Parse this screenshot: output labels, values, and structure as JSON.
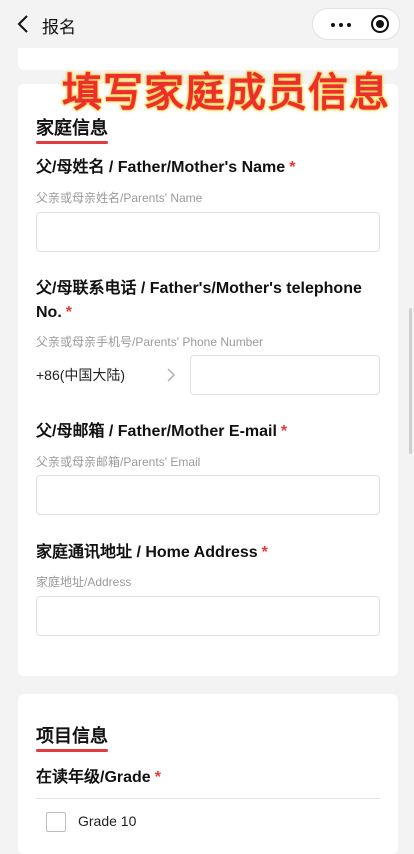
{
  "nav": {
    "title": "报名",
    "back_icon": "chevron-left-icon",
    "more_icon": "more-dots-icon",
    "close_icon": "target-circle-icon"
  },
  "banner": {
    "text": "填写家庭成员信息",
    "color": "#ec2e2c",
    "outline_color": "#fbe06b"
  },
  "family_section": {
    "heading": "家庭信息",
    "fields": [
      {
        "label": "父/母姓名 / Father/Mother's Name",
        "required_mark": "*",
        "hint": "父亲或母亲姓名/Parents' Name",
        "value": ""
      },
      {
        "label": "父/母联系电话 / Father's/Mother's telephone No.",
        "required_mark": "*",
        "hint": "父亲或母亲手机号/Parents' Phone Number",
        "country_code": "+86(中国大陆)",
        "value": ""
      },
      {
        "label": "父/母邮箱 / Father/Mother E-mail",
        "required_mark": "*",
        "hint": "父亲或母亲邮箱/Parents' Email",
        "value": ""
      },
      {
        "label": "家庭通讯地址 / Home Address",
        "required_mark": "*",
        "hint": "家庭地址/Address",
        "value": ""
      }
    ]
  },
  "project_section": {
    "heading": "项目信息",
    "grade_label": "在读年级/Grade",
    "required_mark": "*",
    "options": [
      {
        "label": "Grade 10",
        "checked": false
      }
    ]
  },
  "colors": {
    "accent_red": "#e13b3b",
    "required_red": "#e53935",
    "background": "#f3f3f3"
  }
}
